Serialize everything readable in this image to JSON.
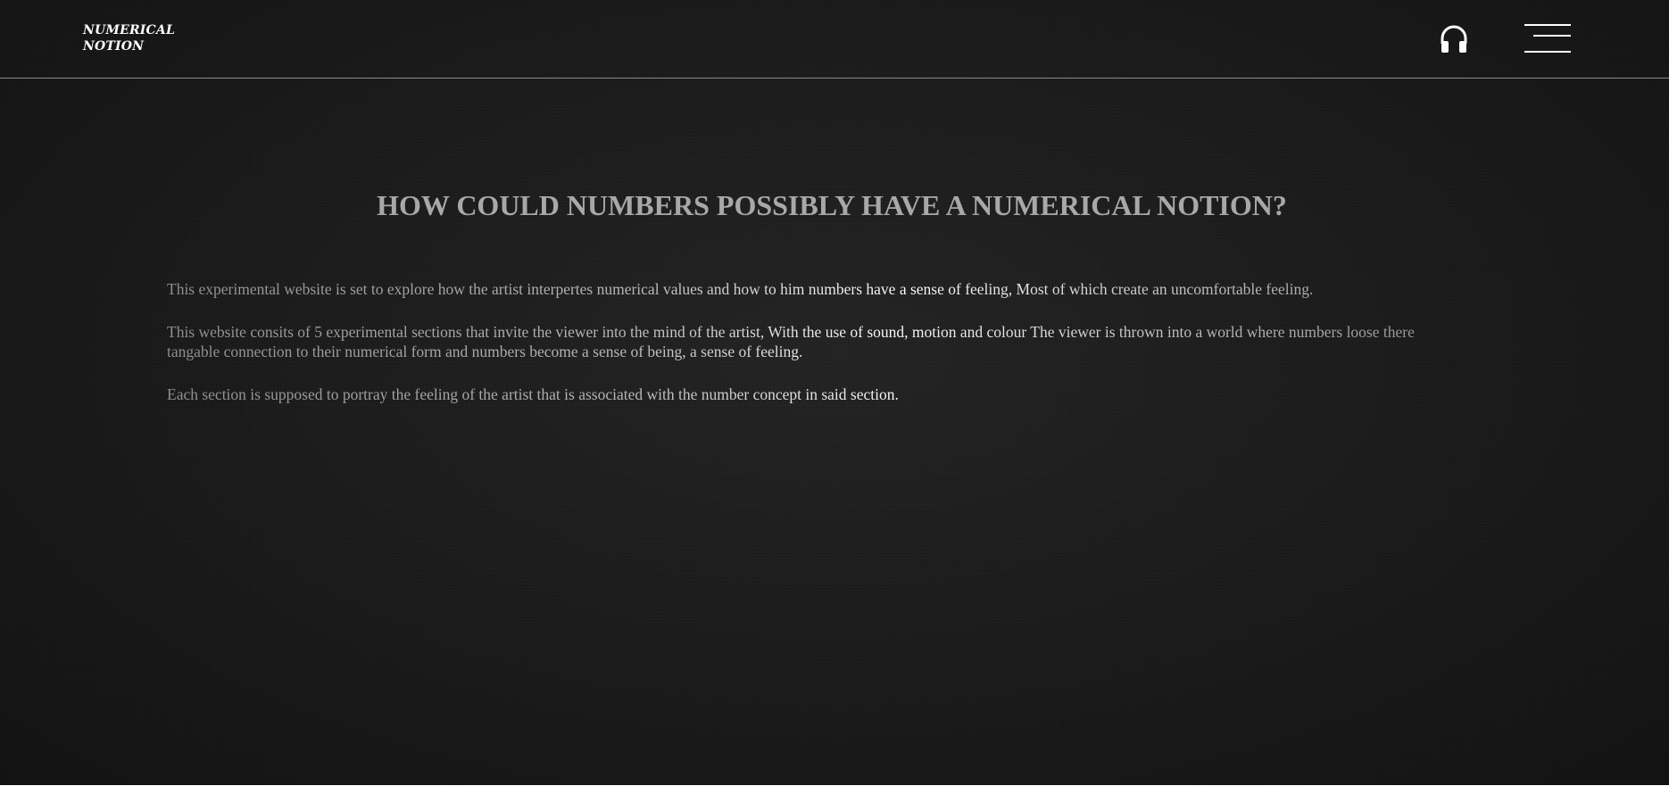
{
  "header": {
    "logo_line1": "NUMERICAL",
    "logo_line2": "NOTION",
    "audio_icon": "headphones-icon",
    "menu_icon": "hamburger-menu-icon"
  },
  "main": {
    "title": "HOW COULD NUMBERS POSSIBLY HAVE A NUMERICAL NOTION?",
    "paragraphs": [
      "This experimental website is set to explore how the artist interpertes numerical values and how to him numbers have a sense of feeling, Most of which create an uncomfortable feeling.",
      "This website consits of 5 experimental sections that invite the viewer into the mind of the artist, With the use of sound, motion and colour The viewer is thrown into a world where numbers loose there tangable connection to their numerical form and numbers become a sense of being, a sense of feeling.",
      "Each section is supposed to portray the feeling of the artist that is associated with the number concept in said section."
    ]
  },
  "colors": {
    "background": "#1a1a1a",
    "title": "#a8a8a8",
    "text_highlight": "#ffffff",
    "text_dim": "#8f8f8f",
    "header_rule": "#8a8a8a"
  }
}
